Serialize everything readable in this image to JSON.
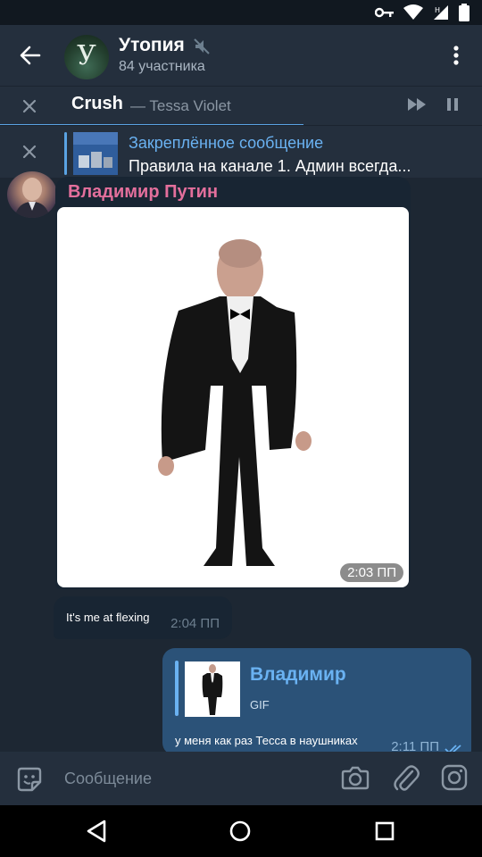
{
  "header": {
    "title": "Утопия",
    "avatar_letter": "У",
    "subtitle": "84 участника"
  },
  "player": {
    "track_title": "Crush",
    "track_artist": "— Tessa Violet",
    "progress_fraction": 0.63
  },
  "pinned": {
    "title": "Закреплённое сообщение",
    "text": "Правила на канале  1. Админ всегда..."
  },
  "messages": {
    "gif_message": {
      "sender": "Владимир Путин",
      "time": "2:03 ПП"
    },
    "text_message": {
      "text": "It's me at flexing",
      "time": "2:04 ПП"
    },
    "outgoing_message": {
      "reply_name": "Владимир",
      "reply_label": "GIF",
      "text": "у меня как раз Тесса в наушниках",
      "time": "2:11 ПП"
    }
  },
  "input": {
    "placeholder": "Сообщение"
  },
  "icons": {
    "status": [
      "key-icon",
      "wifi-icon",
      "cellular-icon",
      "battery-icon"
    ],
    "header": [
      "back-arrow-icon",
      "mute-icon",
      "more-vert-icon"
    ],
    "player": [
      "close-icon",
      "fast-forward-icon",
      "pause-icon"
    ],
    "input": [
      "sticker-icon",
      "camera-icon",
      "paperclip-icon",
      "instagram-icon"
    ],
    "nav": [
      "nav-back-icon",
      "nav-home-icon",
      "nav-recent-icon"
    ]
  },
  "colors": {
    "background": "#1d2733",
    "header": "#242f3d",
    "accent": "#6ab2f2",
    "sender_name": "#e36f9c",
    "outgoing_bubble": "#2b5278",
    "incoming_bubble": "#182533"
  }
}
